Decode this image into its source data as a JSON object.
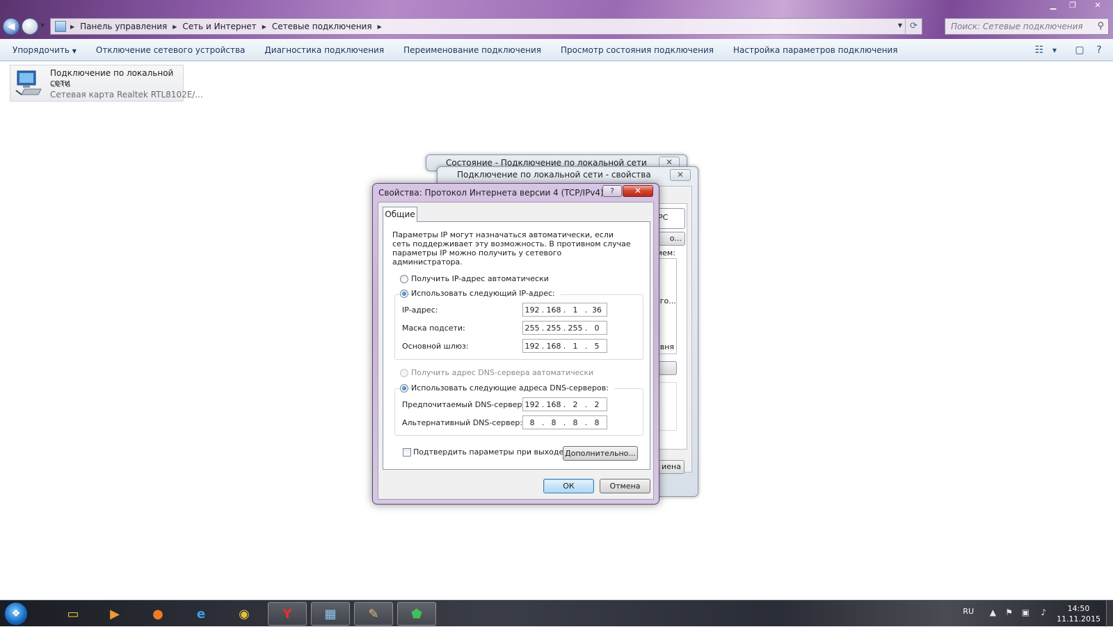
{
  "explorer": {
    "breadcrumbs": [
      "Панель управления",
      "Сеть и Интернет",
      "Сетевые подключения"
    ],
    "search_placeholder": "Поиск: Сетевые подключения",
    "commands": [
      "Упорядочить",
      "Отключение сетевого устройства",
      "Диагностика подключения",
      "Переименование подключения",
      "Просмотр состояния подключения",
      "Настройка параметров подключения"
    ],
    "connection": {
      "name": "Подключение по локальной сети",
      "type": "Сеть",
      "adapter": "Сетевая карта Realtek RTL8102E/..."
    }
  },
  "bg_dialogs": {
    "status_title": "Состояние - Подключение по локальной сети",
    "props_title": "Подключение по локальной сети - свойства",
    "fragments": [
      "PC",
      "о...",
      "ием:",
      "его...",
      "овня",
      "иена"
    ]
  },
  "dialog": {
    "title": "Свойства: Протокол Интернета версии 4 (TCP/IPv4)",
    "help_label": "?",
    "close_label": "✕",
    "tab_label": "Общие",
    "description": "Параметры IP могут назначаться автоматически, если сеть поддерживает эту возможность. В противном случае параметры IP можно получить у сетевого администратора.",
    "ip_auto_label": "Получить IP-адрес автоматически",
    "ip_manual_label": "Использовать следующий IP-адрес:",
    "ip_label": "IP-адрес:",
    "ip": [
      "192",
      "168",
      "1",
      "36"
    ],
    "mask_label": "Маска подсети:",
    "mask": [
      "255",
      "255",
      "255",
      "0"
    ],
    "gateway_label": "Основной шлюз:",
    "gateway": [
      "192",
      "168",
      "1",
      "5"
    ],
    "dns_auto_label": "Получить адрес DNS-сервера автоматически",
    "dns_manual_label": "Использовать следующие адреса DNS-серверов:",
    "dns1_label": "Предпочитаемый DNS-сервер:",
    "dns1": [
      "192",
      "168",
      "2",
      "2"
    ],
    "dns2_label": "Альтернативный DNS-сервер:",
    "dns2": [
      "8",
      "8",
      "8",
      "8"
    ],
    "validate_label": "Подтвердить параметры при выходе",
    "advanced_label": "Дополнительно...",
    "ok_label": "ОК",
    "cancel_label": "Отмена",
    "ip_mode": "manual",
    "dns_mode": "manual",
    "validate_checked": false
  },
  "taskbar": {
    "language": "RU",
    "time": "14:50",
    "date": "11.11.2015"
  },
  "colors": {
    "accent_blue": "#3c7fb1",
    "close_red": "#d0432f",
    "window_frame": "#c9b4d8"
  }
}
